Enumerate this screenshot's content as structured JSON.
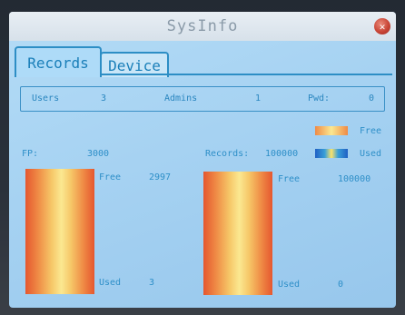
{
  "window": {
    "title": "SysInfo",
    "close_icon": "close-icon"
  },
  "tabs": [
    {
      "label": "Records",
      "active": true
    },
    {
      "label": "Device",
      "active": false
    }
  ],
  "summary": {
    "users_label": "Users",
    "users_value": "3",
    "admins_label": "Admins",
    "admins_value": "1",
    "pwd_label": "Pwd:",
    "pwd_value": "0"
  },
  "legend": {
    "free_label": "Free",
    "used_label": "Used"
  },
  "fp": {
    "label": "FP:",
    "capacity": "3000",
    "free_label": "Free",
    "free_value": "2997",
    "used_label": "Used",
    "used_value": "3"
  },
  "records": {
    "label": "Records:",
    "capacity": "100000",
    "free_label": "Free",
    "free_value": "100000",
    "used_label": "Used",
    "used_value": "0"
  },
  "colors": {
    "accent": "#2d8ec5",
    "screen_bg": "#a6d2f2",
    "bar_free": "#fbe891",
    "bar_edge": "#e5572f",
    "used_blue": "#1f5fc4"
  }
}
